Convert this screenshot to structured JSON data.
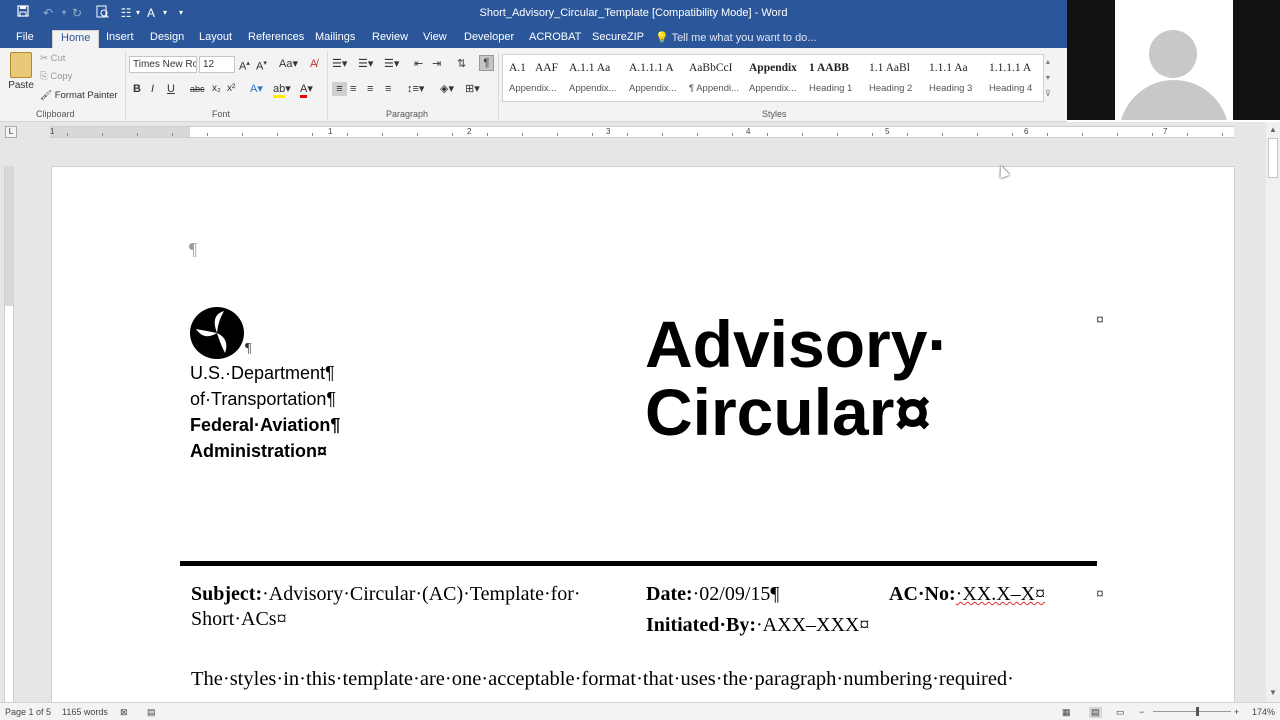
{
  "window": {
    "title": "Short_Advisory_Circular_Template [Compatibility Mode] - Word"
  },
  "quick_access": {
    "save_icon": "save-icon",
    "undo_icon": "undo-icon",
    "redo_icon": "redo-icon",
    "print_preview_icon": "print-preview-icon"
  },
  "tabs": [
    {
      "label": "File"
    },
    {
      "label": "Home"
    },
    {
      "label": "Insert"
    },
    {
      "label": "Design"
    },
    {
      "label": "Layout"
    },
    {
      "label": "References"
    },
    {
      "label": "Mailings"
    },
    {
      "label": "Review"
    },
    {
      "label": "View"
    },
    {
      "label": "Developer"
    },
    {
      "label": "ACROBAT"
    },
    {
      "label": "SecureZIP"
    }
  ],
  "tell_me": "Tell me what you want to do...",
  "clipboard": {
    "paste": "Paste",
    "cut": "Cut",
    "copy": "Copy",
    "format_painter": "Format Painter",
    "group": "Clipboard"
  },
  "font": {
    "name": "Times New Ro",
    "size": "12",
    "group": "Font",
    "bold": "B",
    "italic": "I",
    "underline": "U",
    "strike": "abc",
    "subscript": "x₂",
    "superscript": "x²"
  },
  "paragraph": {
    "group": "Paragraph"
  },
  "styles": {
    "group": "Styles",
    "items": [
      {
        "sample": "A.1",
        "name": "Appendix..."
      },
      {
        "sample": "AAF",
        "name": ""
      },
      {
        "sample": "A.1.1  Aa",
        "name": "Appendix..."
      },
      {
        "sample": "A.1.1.1  A",
        "name": "Appendix..."
      },
      {
        "sample": "AaBbCcI",
        "name": "¶ Appendi..."
      },
      {
        "sample": "Appendix",
        "name": "Appendix..."
      },
      {
        "sample": "1  AABB",
        "name": "Heading 1"
      },
      {
        "sample": "1.1  AaBl",
        "name": "Heading 2"
      },
      {
        "sample": "1.1.1  Aa",
        "name": "Heading 3"
      },
      {
        "sample": "1.1.1.1  A",
        "name": "Heading 4"
      }
    ]
  },
  "ruler": {
    "numbers": [
      "1",
      "1",
      "2",
      "3",
      "4",
      "5",
      "6",
      "7"
    ]
  },
  "document": {
    "pilcrow": "¶",
    "agency": {
      "line1": "U.S.·Department¶",
      "line2": "of·Transportation¶",
      "line3": "Federal·Aviation¶",
      "line4": "Administration¤"
    },
    "logo_pilcrow": "¶",
    "heading": {
      "line1": "Advisory·",
      "line2": "Circular¤"
    },
    "cell_mark": "¤",
    "subject_label": "Subject:",
    "subject_value": "·Advisory·Circular·(AC)·Template·for·",
    "subject_value2": "Short·ACs¤",
    "date_label": "Date:",
    "date_value": "·02/09/15¶",
    "ac_label": "AC·No:",
    "ac_value": "·XX.X–X¤",
    "initiated_label": "Initiated·By:",
    "initiated_value": "·AXX–XXX¤",
    "body": "The·styles·in·this·template·are·one·acceptable·format·that·uses·the·paragraph·numbering·required·"
  },
  "status": {
    "page": "Page 1 of 5",
    "words": "1165 words",
    "zoom": "174%"
  }
}
